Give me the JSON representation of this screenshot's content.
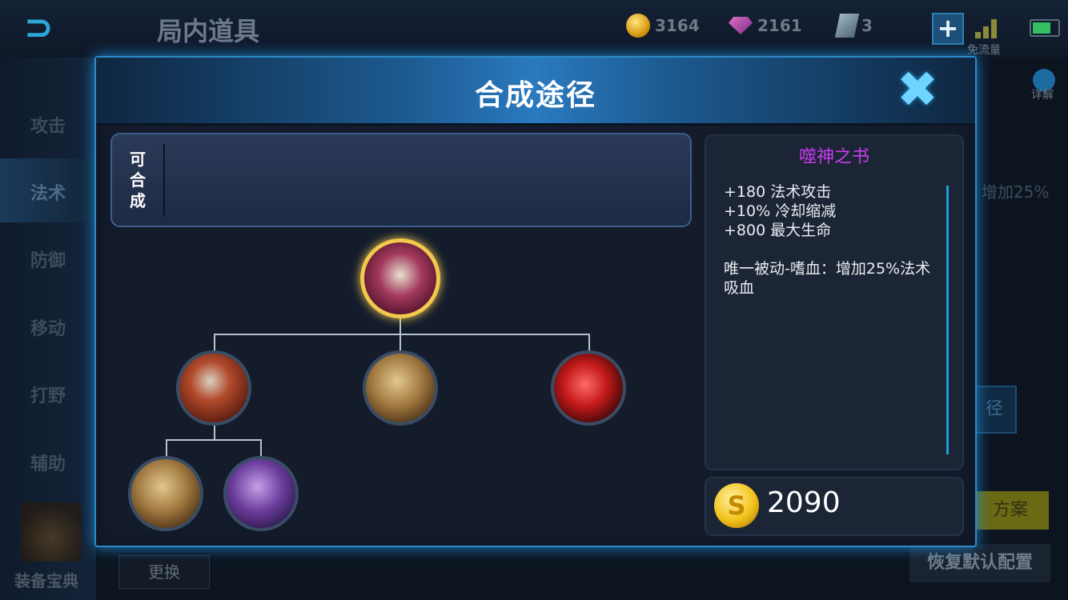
{
  "background": {
    "page_title": "局内道具",
    "currencies": [
      {
        "icon": "gold-coin-icon",
        "value": "3164"
      },
      {
        "icon": "diamond-icon",
        "value": "2161"
      },
      {
        "icon": "voucher-icon",
        "value": "3"
      }
    ],
    "plus_label": "+",
    "free_flow_label": "免流量",
    "detail_label": "详解",
    "sidebar": [
      "攻击",
      "法术",
      "防御",
      "移动",
      "打野",
      "辅助"
    ],
    "right_text": "增加25%",
    "right_path_label": "径",
    "right_plan_label": "方案",
    "restore_label": "恢复默认配置",
    "change_label": "更换",
    "codex_label": "装备宝典"
  },
  "modal": {
    "title": "合成途径",
    "close_icon": "✖",
    "composable_label": "可合成",
    "tree": {
      "root": {
        "name": "噬神之书",
        "icon": "tome-icon"
      },
      "children": [
        {
          "icon": "red-tome-icon",
          "children": [
            {
              "icon": "book-icon"
            },
            {
              "icon": "purple-book-icon"
            }
          ]
        },
        {
          "icon": "book-icon"
        },
        {
          "icon": "red-gem-icon"
        }
      ]
    },
    "info": {
      "name": "噬神之书",
      "stats": [
        "+180 法术攻击",
        "+10% 冷却缩减",
        "+800 最大生命"
      ],
      "passive": "唯一被动-嗜血：增加25%法术吸血"
    },
    "price": {
      "coin_symbol": "S",
      "value": "2090"
    }
  },
  "colors": {
    "accent": "#2d8bc6",
    "item_name": "#c83cf0",
    "gold": "#f2c94c"
  }
}
